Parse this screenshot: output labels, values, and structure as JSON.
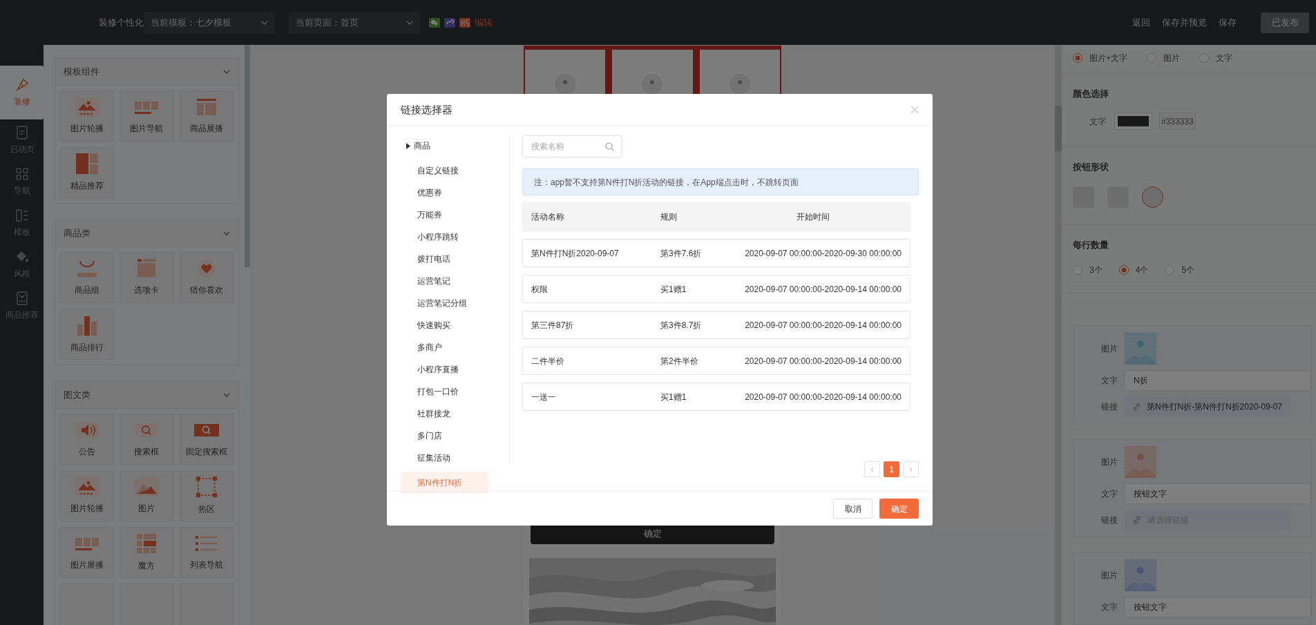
{
  "top_bar": {
    "title": "装修个性化",
    "template_select": "当前模板：七夕模板",
    "page_select": "当前页面：首页",
    "edit_link": "编辑",
    "actions": [
      "返回",
      "保存并预览",
      "保存"
    ],
    "publish_button": {
      "label": "已发布",
      "disabled": true
    }
  },
  "nav_rail": [
    {
      "label": "装修",
      "selected": true
    },
    {
      "label": "启动页",
      "selected": false
    },
    {
      "label": "导航",
      "selected": false
    },
    {
      "label": "模板",
      "selected": false
    },
    {
      "label": "风格",
      "selected": false
    },
    {
      "label": "商品推荐",
      "selected": false
    }
  ],
  "component_panel": {
    "sections": [
      {
        "title": "模板组件",
        "expanded": true,
        "items": [
          "图片轮播",
          "图片导航",
          "商品展播",
          "精品推荐"
        ]
      },
      {
        "title": "商品类",
        "expanded": true,
        "items": [
          "商品组",
          "选项卡",
          "猜你喜欢",
          "商品排行"
        ]
      },
      {
        "title": "图文类",
        "expanded": true,
        "items": [
          "公告",
          "搜索框",
          "固定搜索框",
          "图片轮播",
          "图片",
          "热区",
          "图片展播",
          "魔方",
          "列表导航"
        ]
      }
    ]
  },
  "canvas": {
    "button_label": "确定"
  },
  "settings_panel": {
    "display_options": [
      {
        "label": "图片+文字",
        "selected": true
      },
      {
        "label": "图片",
        "selected": false
      },
      {
        "label": "文字",
        "selected": false
      }
    ],
    "color_section": {
      "title": "颜色选择",
      "label": "文字",
      "value": "#333333"
    },
    "shape_section": {
      "title": "按钮形状",
      "shapes": [
        {
          "kind": "square",
          "selected": false
        },
        {
          "kind": "rounded",
          "selected": false
        },
        {
          "kind": "circle",
          "selected": true
        }
      ]
    },
    "per_row_section": {
      "title": "每行数量",
      "options": [
        {
          "label": "3个",
          "selected": false
        },
        {
          "label": "4个",
          "selected": true
        },
        {
          "label": "5个",
          "selected": false
        }
      ]
    },
    "items": [
      {
        "image_label": "图片",
        "text_label": "文字",
        "text_value": "N折",
        "link_label": "链接",
        "link_value": "第N件打N折-第N件打N折2020-09-07"
      },
      {
        "image_label": "图片",
        "text_label": "文字",
        "text_value": "按钮文字",
        "link_label": "链接",
        "link_placeholder": "请选择链接"
      },
      {
        "image_label": "图片",
        "text_label": "文字",
        "text_value": "按钮文字"
      }
    ]
  },
  "modal": {
    "title": "链接选择器",
    "categories": [
      {
        "label": "商品",
        "kind": "group",
        "expanded": false,
        "selected": false
      },
      {
        "label": "自定义链接",
        "kind": "item",
        "selected": false
      },
      {
        "label": "优惠券",
        "kind": "item",
        "selected": false
      },
      {
        "label": "万能券",
        "kind": "item",
        "selected": false
      },
      {
        "label": "小程序跳转",
        "kind": "item",
        "selected": false
      },
      {
        "label": "拨打电话",
        "kind": "item",
        "selected": false
      },
      {
        "label": "运营笔记",
        "kind": "item",
        "selected": false
      },
      {
        "label": "运营笔记分组",
        "kind": "item",
        "selected": false
      },
      {
        "label": "快速购买",
        "kind": "item",
        "selected": false
      },
      {
        "label": "多商户",
        "kind": "item",
        "selected": false
      },
      {
        "label": "小程序直播",
        "kind": "item",
        "selected": false
      },
      {
        "label": "打包一口价",
        "kind": "item",
        "selected": false
      },
      {
        "label": "社群接龙",
        "kind": "item",
        "selected": false
      },
      {
        "label": "多门店",
        "kind": "item",
        "selected": false
      },
      {
        "label": "征集活动",
        "kind": "item",
        "selected": false
      },
      {
        "label": "第N件打N折",
        "kind": "item",
        "selected": true
      }
    ],
    "search": {
      "placeholder": "搜索名称"
    },
    "notice": "注：app暂不支持第N件打N折活动的链接，在App端点击时，不跳转页面",
    "table": {
      "columns": [
        "活动名称",
        "规则",
        "开始时间"
      ],
      "rows": [
        [
          "第N件打N折2020-09-07",
          "第3件7.6折",
          "2020-09-07 00:00:00-2020-09-30 00:00:00"
        ],
        [
          "权限",
          "买1赠1",
          "2020-09-07 00:00:00-2020-09-14 00:00:00"
        ],
        [
          "第三件87折",
          "第3件8.7折",
          "2020-09-07 00:00:00-2020-09-14 00:00:00"
        ],
        [
          "二件半价",
          "第2件半价",
          "2020-09-07 00:00:00-2020-09-14 00:00:00"
        ],
        [
          "一送一",
          "买1赠1",
          "2020-09-07 00:00:00-2020-09-14 00:00:00"
        ]
      ]
    },
    "pagination": {
      "prev": "‹",
      "pages": [
        {
          "label": "1",
          "selected": true
        }
      ],
      "next": "›"
    },
    "buttons": {
      "cancel": "取消",
      "confirm": "确定"
    }
  }
}
